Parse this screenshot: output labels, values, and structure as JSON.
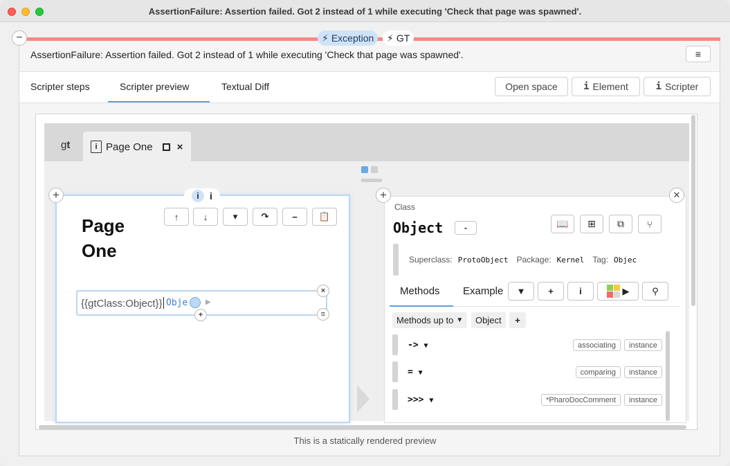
{
  "window": {
    "title": "AssertionFailure: Assertion failed. Got 2 instead of 1 while executing 'Check that page was spawned'."
  },
  "inspector": {
    "tags": [
      {
        "label": "Exception",
        "icon": "lightning-icon"
      },
      {
        "label": "GT",
        "icon": "lightning-icon"
      }
    ],
    "error_message": "AssertionFailure: Assertion failed. Got 2 instead of 1 while executing 'Check that page was spawned'.",
    "menu_glyph": "≡"
  },
  "tabs": {
    "items": [
      "Scripter steps",
      "Scripter preview",
      "Textual Diff"
    ],
    "active": "Scripter preview"
  },
  "toolbar": {
    "open_space": "Open space",
    "element": "Element",
    "scripter": "Scripter"
  },
  "preview": {
    "footer": "This is a statically rendered preview",
    "gt_logo_g": "g",
    "gt_logo_t": "t",
    "page_tab_label": "Page One",
    "close_glyph": "×"
  },
  "left_page": {
    "title_line1": "Page",
    "title_line2": "One",
    "snippet_text": "{{gtClass:Object}}",
    "snippet_object": "Object",
    "snippet_object_part1": "Obje",
    "snippet_object_part2": "t",
    "toolbar_icons": [
      "arrow-up-icon",
      "arrow-down-icon",
      "chevron-down-icon",
      "share-icon",
      "minus-icon",
      "clipboard-icon"
    ]
  },
  "class_pane": {
    "label": "Class",
    "name": "Object",
    "minus": "-",
    "superclass_label": "Superclass:",
    "superclass_value": "ProtoObject",
    "package_label": "Package:",
    "package_value": "Kernel",
    "tag_label": "Tag:",
    "tag_value": "Objec",
    "tabs": [
      "Methods",
      "Example"
    ],
    "active_tab": "Methods",
    "scope_label": "Methods up to",
    "scope_value": "Object",
    "add_glyph": "+",
    "methods": [
      {
        "name": "->",
        "tags": [
          "associating",
          "instance"
        ]
      },
      {
        "name": "=",
        "tags": [
          "comparing",
          "instance"
        ]
      },
      {
        "name": ">>>",
        "tags": [
          "*PharoDocComment",
          "instance"
        ]
      }
    ]
  },
  "colors": {
    "accent": "#5aa0e6",
    "error_bar": "#f28b82",
    "tag_bg": "#cfe3f7"
  }
}
